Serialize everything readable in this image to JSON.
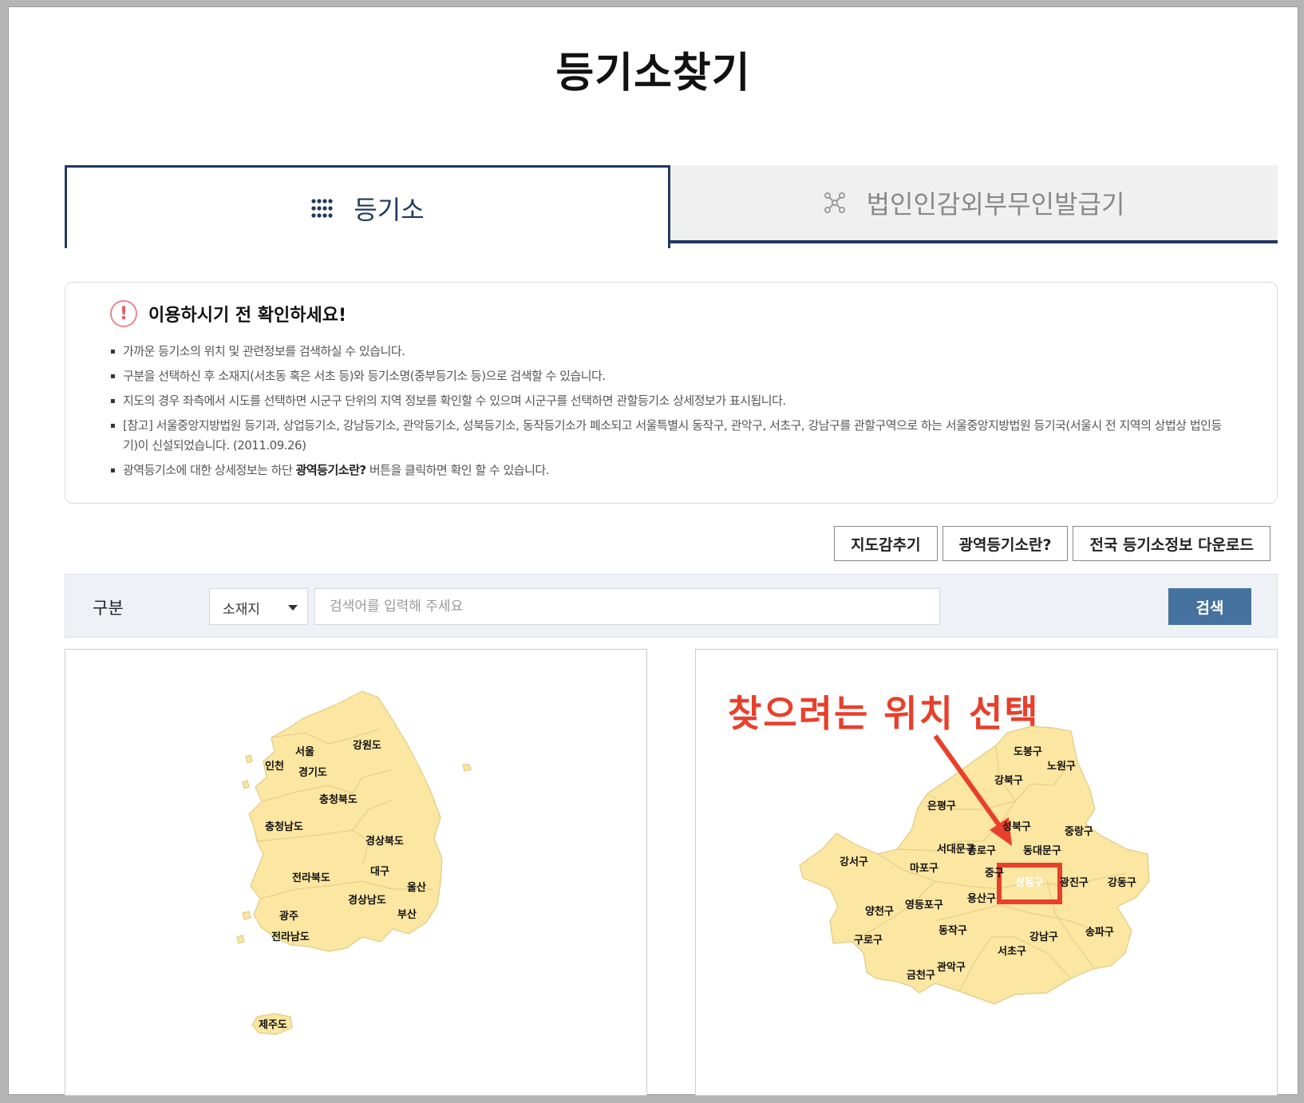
{
  "page": {
    "title": "등기소찾기"
  },
  "tabs": [
    {
      "label": "등기소",
      "icon": "dot-grid-icon",
      "active": true
    },
    {
      "label": "법인인감외부무인발급기",
      "icon": "network-icon",
      "active": false
    }
  ],
  "notice": {
    "title": "이용하시기 전 확인하세요!",
    "items": [
      "가까운 등기소의 위치 및 관련정보를 검색하실 수 있습니다.",
      "구분을 선택하신 후 소재지(서초동 혹은 서초 등)와 등기소명(중부등기소 등)으로 검색할 수 있습니다.",
      "지도의 경우 좌측에서 시도를 선택하면 시군구 단위의 지역 정보를 확인할 수 있으며 시군구를 선택하면 관할등기소 상세정보가 표시됩니다.",
      "[참고] 서울중앙지방법원 등기과, 상업등기소, 강남등기소, 관악등기소, 성북등기소, 동작등기소가 폐소되고 서울특별시 동작구, 관악구, 서초구, 강남구를 관할구역으로 하는 서울중앙지방법원 등기국(서울시 전 지역의 상법상 법인등기)이 신설되었습니다. (2011.09.26)"
    ],
    "last_item_pre": "광역등기소에 대한 상세정보는 하단 ",
    "last_item_bold": "광역등기소란?",
    "last_item_post": " 버튼을 클릭하면 확인 할 수 있습니다."
  },
  "buttons": {
    "hide_map": "지도감추기",
    "regional": "광역등기소란?",
    "download": "전국 등기소정보 다운로드"
  },
  "search": {
    "label": "구분",
    "select_value": "소재지",
    "placeholder": "검색어를 입력해 주세요",
    "button": "검색"
  },
  "korea_map": {
    "regions": [
      "서울",
      "인천",
      "강원도",
      "경기도",
      "충청북도",
      "충청남도",
      "경상북도",
      "대구",
      "전라북도",
      "울산",
      "경상남도",
      "광주",
      "부산",
      "전라남도",
      "제주도"
    ]
  },
  "seoul_map": {
    "annotation": "찾으려는 위치 선택",
    "selected": "성동구",
    "districts": [
      "도봉구",
      "노원구",
      "강북구",
      "은평구",
      "성북구",
      "중랑구",
      "강서구",
      "서대문구",
      "종로구",
      "동대문구",
      "마포구",
      "중구",
      "성동구",
      "광진구",
      "강동구",
      "양천구",
      "영등포구",
      "용산구",
      "동작구",
      "강남구",
      "송파구",
      "구로구",
      "서초구",
      "금천구",
      "관악구"
    ]
  },
  "colors": {
    "navy": "#1f3a5f",
    "map_fill": "#fbe6a2",
    "highlight": "#e8402b",
    "search_btn": "#45729f"
  }
}
